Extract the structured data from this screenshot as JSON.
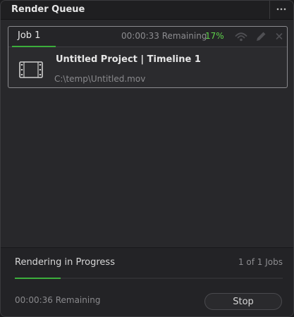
{
  "header": {
    "title": "Render Queue",
    "menu_icon": "more-dots-icon"
  },
  "job": {
    "tab_label": "Job 1",
    "remaining": "00:00:33 Remaining",
    "percent": "17%",
    "project_title": "Untitled Project | Timeline 1",
    "file_path": "C:\\temp\\Untitled.mov",
    "thumbnail_icon": "film-clip-icon",
    "action_icons": [
      "remote-render-icon",
      "edit-pencil-icon",
      "close-icon"
    ]
  },
  "footer": {
    "status": "Rendering in Progress",
    "jobs_count": "1 of 1 Jobs",
    "remaining": "00:00:36 Remaining",
    "stop_label": "Stop",
    "progress_fraction": 0.17
  },
  "colors": {
    "accent_green": "#3cae3c",
    "percent_green": "#5fd24b",
    "panel_bg": "#28282b"
  }
}
